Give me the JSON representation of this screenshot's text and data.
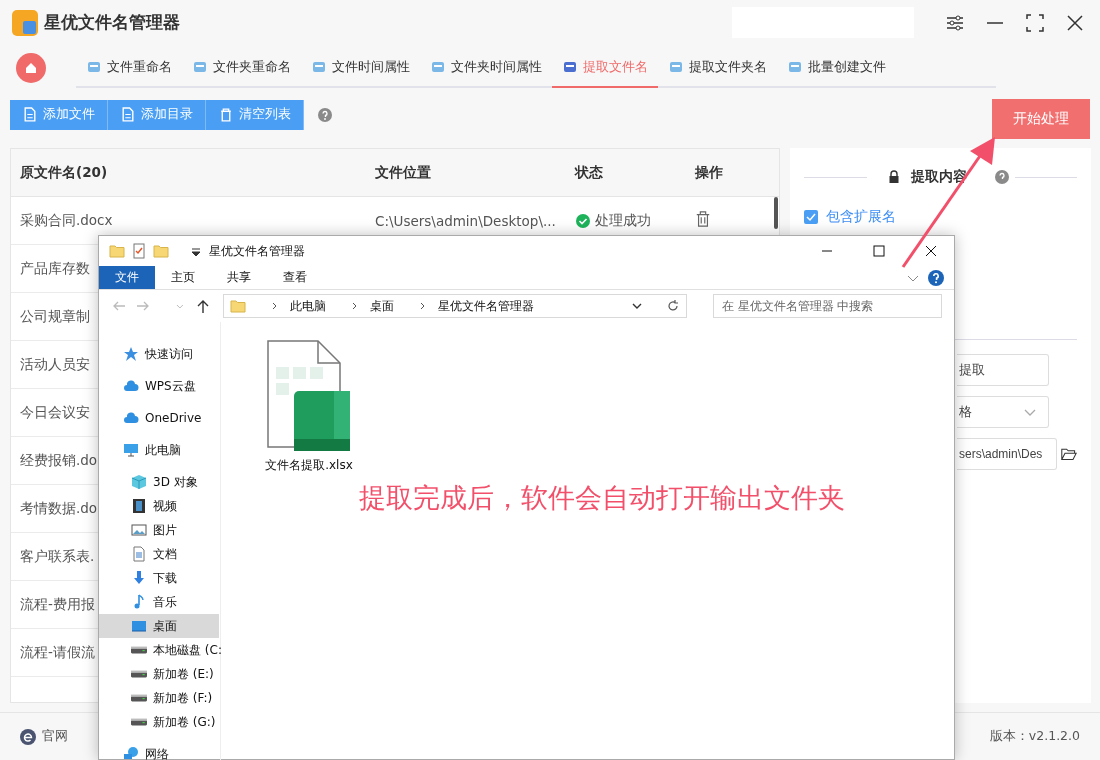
{
  "app": {
    "title": "星优文件名管理器"
  },
  "tabs": [
    {
      "label": "文件重命名",
      "selected": false
    },
    {
      "label": "文件夹重命名",
      "selected": false
    },
    {
      "label": "文件时间属性",
      "selected": false
    },
    {
      "label": "文件夹时间属性",
      "selected": false
    },
    {
      "label": "提取文件名",
      "selected": true
    },
    {
      "label": "提取文件夹名",
      "selected": false
    },
    {
      "label": "批量创建文件",
      "selected": false
    }
  ],
  "toolbar": {
    "buttons": [
      {
        "label": "添加文件",
        "kind": "file"
      },
      {
        "label": "添加目录",
        "kind": "file"
      },
      {
        "label": "清空列表",
        "kind": "trash"
      }
    ],
    "start_button": "开始处理"
  },
  "table": {
    "columns": [
      "原文件名(20)",
      "文件位置",
      "状态",
      "操作"
    ],
    "rows": [
      {
        "name": "采购合同.docx",
        "location": "C:\\Users\\admin\\Desktop\\...",
        "status": "处理成功"
      },
      {
        "name": "产品库存数"
      },
      {
        "name": "公司规章制"
      },
      {
        "name": "活动人员安"
      },
      {
        "name": "今日会议安"
      },
      {
        "name": "经费报销.do"
      },
      {
        "name": "考情数据.do"
      },
      {
        "name": "客户联系表."
      },
      {
        "name": "流程-费用报"
      },
      {
        "name": "流程-请假流"
      }
    ]
  },
  "options": {
    "title": "提取内容",
    "include_extension": {
      "label": "包含扩展名",
      "checked": true
    },
    "fields": [
      {
        "kind": "text",
        "value": "提取"
      },
      {
        "kind": "select",
        "value": "格"
      },
      {
        "kind": "path",
        "value": "sers\\admin\\Des"
      }
    ]
  },
  "footer": {
    "link": "官网",
    "version": "版本：v2.1.2.0"
  },
  "explorer": {
    "title": "星优文件名管理器",
    "ribbon_tabs": [
      {
        "label": "文件",
        "selected": true
      },
      {
        "label": "主页",
        "selected": false
      },
      {
        "label": "共享",
        "selected": false
      },
      {
        "label": "查看",
        "selected": false
      }
    ],
    "breadcrumb": [
      "此电脑",
      "桌面",
      "星优文件名管理器"
    ],
    "search_placeholder": "在 星优文件名管理器 中搜索",
    "nav": [
      {
        "label": "快速访问",
        "kind": "star",
        "selected": false
      },
      {
        "label": "WPS云盘",
        "kind": "cloud",
        "selected": false
      },
      {
        "label": "OneDrive",
        "kind": "cloud",
        "selected": false
      },
      {
        "label": "此电脑",
        "kind": "pc",
        "selected": false,
        "children": [
          {
            "label": "3D 对象",
            "kind": "cube",
            "selected": false
          },
          {
            "label": "视频",
            "kind": "film",
            "selected": false
          },
          {
            "label": "图片",
            "kind": "image",
            "selected": false
          },
          {
            "label": "文档",
            "kind": "doc",
            "selected": false
          },
          {
            "label": "下载",
            "kind": "download",
            "selected": false
          },
          {
            "label": "音乐",
            "kind": "music",
            "selected": false
          },
          {
            "label": "桌面",
            "kind": "desktop",
            "selected": true
          },
          {
            "label": "本地磁盘 (C:",
            "kind": "drive",
            "selected": false
          },
          {
            "label": "新加卷 (E:)",
            "kind": "drive",
            "selected": false
          },
          {
            "label": "新加卷 (F:)",
            "kind": "drive",
            "selected": false
          },
          {
            "label": "新加卷 (G:)",
            "kind": "drive",
            "selected": false
          }
        ]
      },
      {
        "label": "网络",
        "kind": "network",
        "selected": false
      }
    ],
    "files": [
      {
        "name": "文件名提取.xlsx"
      }
    ]
  },
  "annotation": {
    "text": "提取完成后，软件会自动打开输出文件夹"
  }
}
